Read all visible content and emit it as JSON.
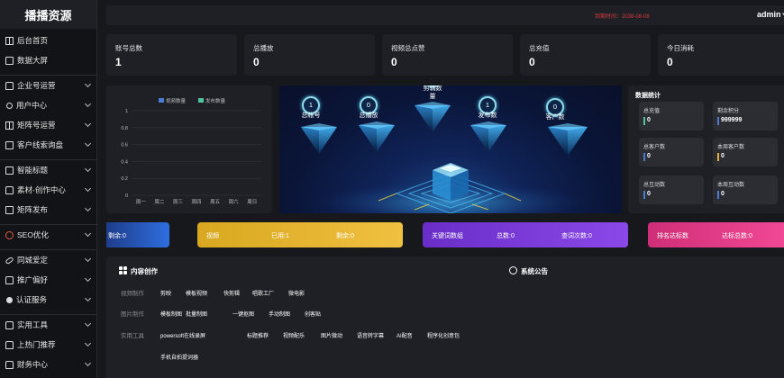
{
  "brand": "播播资源",
  "sidebar": {
    "items": [
      {
        "label": "后台首页",
        "icon": "home-icon",
        "chev": false
      },
      {
        "label": "数据大屏",
        "icon": "screen-icon",
        "chev": false
      },
      {
        "label": "企业号运营",
        "icon": "briefcase-icon",
        "chev": true
      },
      {
        "label": "用户中心",
        "icon": "user-icon",
        "chev": true
      },
      {
        "label": "矩阵号运营",
        "icon": "matrix-icon",
        "chev": true
      },
      {
        "label": "客户线索询盘",
        "icon": "chat-icon",
        "chev": true
      },
      {
        "label": "智能标题",
        "icon": "title-icon",
        "chev": true
      },
      {
        "label": "素材-创作中心",
        "icon": "material-icon",
        "chev": true
      },
      {
        "label": "矩阵发布",
        "icon": "publish-icon",
        "chev": true
      },
      {
        "label": "SEO优化",
        "icon": "seo-icon",
        "chev": true
      },
      {
        "label": "同城爱定",
        "icon": "link-icon",
        "chev": true
      },
      {
        "label": "推广偏好",
        "icon": "promote-icon",
        "chev": true
      },
      {
        "label": "认证服务",
        "icon": "certify-icon",
        "chev": true
      },
      {
        "label": "实用工具",
        "icon": "tool-icon",
        "chev": true
      },
      {
        "label": "上热门推荐",
        "icon": "hot-icon",
        "chev": true
      },
      {
        "label": "财务中心",
        "icon": "finance-icon",
        "chev": true
      }
    ]
  },
  "header": {
    "date": "到期时间：2038-08-08",
    "user": "admin"
  },
  "stats": [
    {
      "label": "账号总数",
      "value": "1"
    },
    {
      "label": "总播放",
      "value": "0"
    },
    {
      "label": "视频总点赞",
      "value": "0"
    },
    {
      "label": "总充值",
      "value": "0"
    },
    {
      "label": "今日消耗",
      "value": "0"
    }
  ],
  "chart_data": {
    "type": "bar",
    "categories": [
      "周一",
      "周二",
      "周三",
      "周四",
      "周五",
      "周六",
      "周日"
    ],
    "series": [
      {
        "name": "视频数量",
        "color": "#4a7bd4",
        "values": [
          0,
          0,
          0,
          0,
          0,
          0,
          0
        ]
      },
      {
        "name": "发布数量",
        "color": "#4fc39a",
        "values": [
          0,
          0,
          0,
          0,
          0,
          0,
          0
        ]
      }
    ],
    "yticks": [
      "0",
      "0.2",
      "0.4",
      "0.6",
      "0.8",
      "1"
    ],
    "ylim": [
      0,
      1
    ],
    "grid": true,
    "legend": "top"
  },
  "visual": {
    "nodes": [
      {
        "label": "总帐号",
        "value": "1"
      },
      {
        "label": "总播放",
        "value": "0"
      },
      {
        "label": "剪辑数量",
        "value": "0"
      },
      {
        "label": "发布数",
        "value": "1"
      },
      {
        "label": "客户数",
        "value": "0"
      }
    ]
  },
  "data_stats": {
    "title": "数据统计",
    "items": [
      {
        "label": "总充值",
        "value": "0",
        "color": "#4fc39a"
      },
      {
        "label": "剩余积分",
        "value": "999999",
        "color": "#4a7bd4"
      },
      {
        "label": "总客户数",
        "value": "0",
        "color": "#4a7bd4"
      },
      {
        "label": "本周客户数",
        "value": "0",
        "color": "#e0b040"
      },
      {
        "label": "总互动数",
        "value": "0",
        "color": "#4a7bd4"
      },
      {
        "label": "本周互动数",
        "value": "0",
        "color": "#4a7bd4"
      }
    ]
  },
  "bars": {
    "blue": {
      "text": "剩余:0"
    },
    "yellow": {
      "a": "视频",
      "b": "已用:1",
      "c": "剩余:0"
    },
    "purple": {
      "a": "关键词数组",
      "b": "总数:0",
      "c": "查词次数:0"
    },
    "pink": {
      "a": "排名达标数",
      "b": "达标总数:0"
    }
  },
  "content": {
    "title": "内容创作",
    "notice": "系统公告",
    "rows": [
      {
        "label": "视频制作",
        "links": [
          "剪映",
          "模板视频",
          "快剪辑",
          "唱歌工厂",
          "微电影"
        ]
      },
      {
        "label": "图片制作",
        "links": [
          "模板制图",
          "批量制图",
          "一键抠图",
          "手动制图",
          "创客贴"
        ]
      },
      {
        "label": "实用工具",
        "links": [
          "powersoft在线录屏",
          "标题推荐",
          "视频配乐",
          "图片微动",
          "语音转字幕",
          "AI配音",
          "程序化创意包"
        ]
      },
      {
        "label": "",
        "links": [
          "手机自拍提词器"
        ]
      }
    ]
  }
}
